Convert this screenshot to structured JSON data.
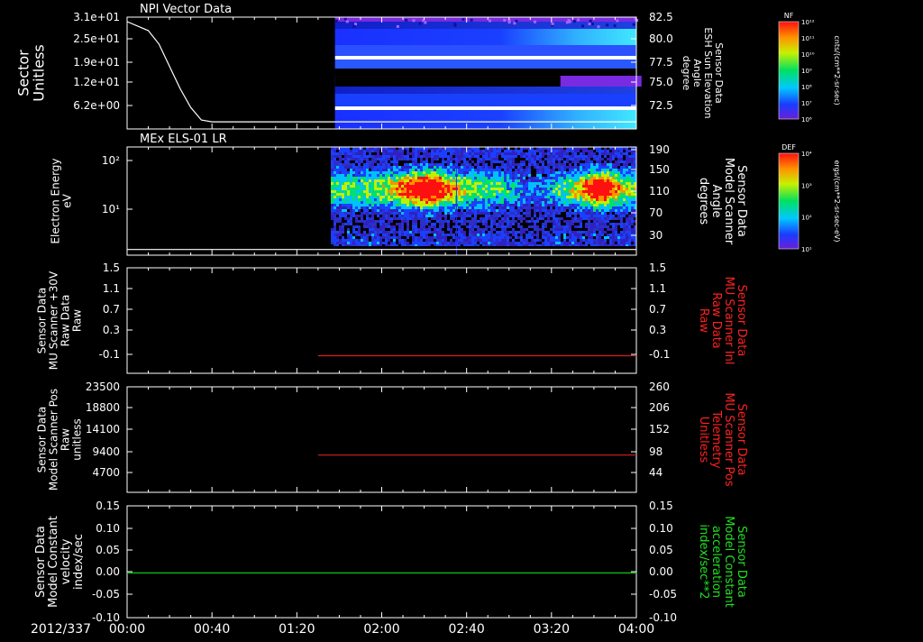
{
  "date_label": "2012/337",
  "time_axis": {
    "start_min": 0,
    "end_min": 240,
    "tick_labels": [
      "00:00",
      "00:40",
      "01:20",
      "02:00",
      "02:40",
      "03:20",
      "04:00"
    ],
    "tick_minutes": [
      0,
      40,
      80,
      120,
      160,
      200,
      240
    ]
  },
  "colors": {
    "frame": "#ffffff",
    "red_trace": "#d81e1e",
    "green_trace": "#10c810",
    "red_label": "#ff2020",
    "green_label": "#20e020"
  },
  "chart_data": [
    {
      "id": "npi",
      "type": "heatmap",
      "title": "NPI Vector Data",
      "ylabel_left": [
        "Sector",
        "Unitless"
      ],
      "left_ticks": [
        "3.1e+01",
        "2.5e+01",
        "1.9e+01",
        "1.2e+01",
        "6.2e+00"
      ],
      "ylim_left": [
        0,
        31
      ],
      "ylabel_right": [
        "Sensor Data",
        "ESH Sun Elevation",
        "Angle",
        "degree"
      ],
      "right_ticks": [
        "82.5",
        "80.0",
        "77.5",
        "75.0",
        "72.5"
      ],
      "ylim_right": [
        70,
        82.5
      ],
      "line": {
        "name": "Sun Elevation",
        "x": [
          0,
          10,
          15,
          20,
          25,
          30,
          35,
          40,
          45,
          240
        ],
        "y": [
          82,
          81,
          79.5,
          77,
          74.5,
          72.4,
          71.0,
          70.8,
          70.8,
          70.8
        ]
      },
      "spectrogram_start_min": 98,
      "colorbar": {
        "label": "NF",
        "units": "cnts/(cm**2-sr-sec)",
        "tick_labels": [
          "10¹²",
          "10¹¹",
          "10¹⁰",
          "10⁹",
          "10⁸",
          "10⁷",
          "10⁶"
        ]
      }
    },
    {
      "id": "els",
      "type": "heatmap",
      "title": "MEx ELS-01 LR",
      "ylabel_left": [
        "Electron Energy",
        "eV"
      ],
      "left_ticks": [
        "10²",
        "10¹"
      ],
      "ylim_left": [
        1,
        300
      ],
      "yscale_left": "log",
      "ylabel_right": [
        "Sensor Data",
        "Model Scanner",
        "Angle",
        "degrees"
      ],
      "right_ticks": [
        "190",
        "150",
        "110",
        "70",
        "30"
      ],
      "ylim_right": [
        0,
        190
      ],
      "baseline_value": 10,
      "spectrogram_start_min": 96,
      "colorbar": {
        "label": "DEF",
        "units": "ergs/(cm**2-sr-sec-eV)",
        "tick_labels": [
          "10⁴",
          "10³",
          "10²",
          "10¹"
        ]
      }
    },
    {
      "id": "mu_raw",
      "type": "line",
      "ylabel_left": [
        "Sensor Data",
        "MU Scanner +30V",
        "Raw Data",
        "Raw"
      ],
      "left_ticks": [
        "1.5",
        "1.1",
        "0.7",
        "0.3",
        "-0.1"
      ],
      "ylim_left": [
        -0.3,
        1.5
      ],
      "ylabel_right": [
        "Sensor Data",
        "MU Scanner Inl",
        "Raw Data",
        "Raw"
      ],
      "right_ticks": [
        "1.5",
        "1.1",
        "0.7",
        "0.3",
        "-0.1"
      ],
      "right_label_color": "red",
      "series": [
        {
          "x": [
            90,
            240
          ],
          "y": [
            0.0,
            0.0
          ],
          "color": "red"
        }
      ]
    },
    {
      "id": "scanner_pos",
      "type": "line",
      "ylabel_left": [
        "Sensor Data",
        "Model Scanner Pos",
        "Raw",
        "unitless"
      ],
      "left_ticks": [
        "23500",
        "18800",
        "14100",
        "9400",
        "4700"
      ],
      "ylim_left": [
        0,
        23500
      ],
      "ylabel_right": [
        "Sensor Data",
        "MU Scanner Pos",
        "Telemetry",
        "Unitless"
      ],
      "right_ticks": [
        "260",
        "206",
        "152",
        "98",
        "44"
      ],
      "ylim_right": [
        0,
        260
      ],
      "right_label_color": "red",
      "series": [
        {
          "x": [
            90,
            240
          ],
          "y": [
            8300,
            8300
          ],
          "color": "red"
        }
      ]
    },
    {
      "id": "constants",
      "type": "line",
      "ylabel_left": [
        "Sensor Data",
        "Model Constant",
        "velocity",
        "index/sec"
      ],
      "left_ticks": [
        "0.15",
        "0.10",
        "0.05",
        "0.00",
        "-0.05",
        "-0.10"
      ],
      "ylim_left": [
        -0.1,
        0.15
      ],
      "ylabel_right": [
        "Sensor Data",
        "Model Constant",
        "acceleration",
        "index/sec**2"
      ],
      "right_ticks": [
        "0.15",
        "0.10",
        "0.05",
        "0.00",
        "-0.05",
        "-0.10"
      ],
      "right_label_color": "green",
      "series": [
        {
          "x": [
            0,
            240
          ],
          "y": [
            0.0,
            0.0
          ],
          "color": "green"
        }
      ]
    }
  ]
}
